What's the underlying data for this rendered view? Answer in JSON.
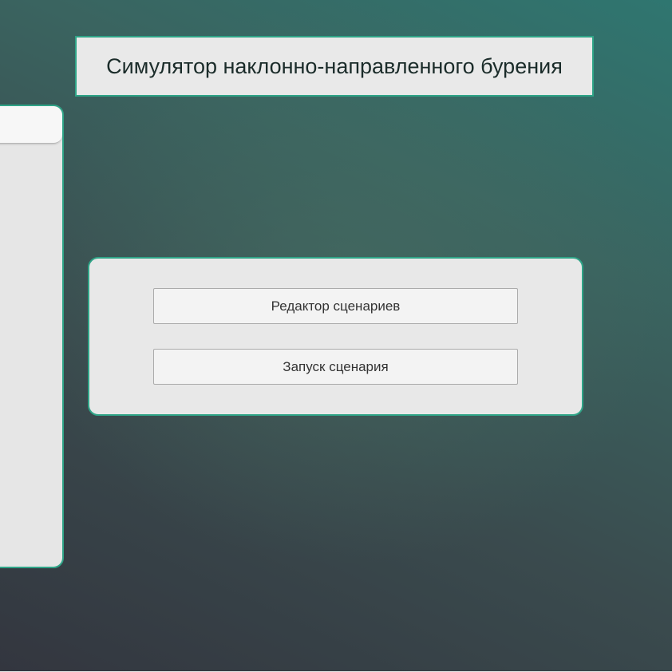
{
  "app": {
    "title": "Симулятор наклонно-направленного бурения"
  },
  "side_panel": {
    "header": ""
  },
  "menu": {
    "buttons": [
      {
        "label": "Редактор сценариев"
      },
      {
        "label": "Запуск сценария"
      }
    ]
  },
  "colors": {
    "accent_border": "#2fa487",
    "panel_background": "#e8e8e8",
    "button_background": "#f3f3f3",
    "background_top_right": "#2f7670",
    "background_bottom_left": "#33363f"
  }
}
